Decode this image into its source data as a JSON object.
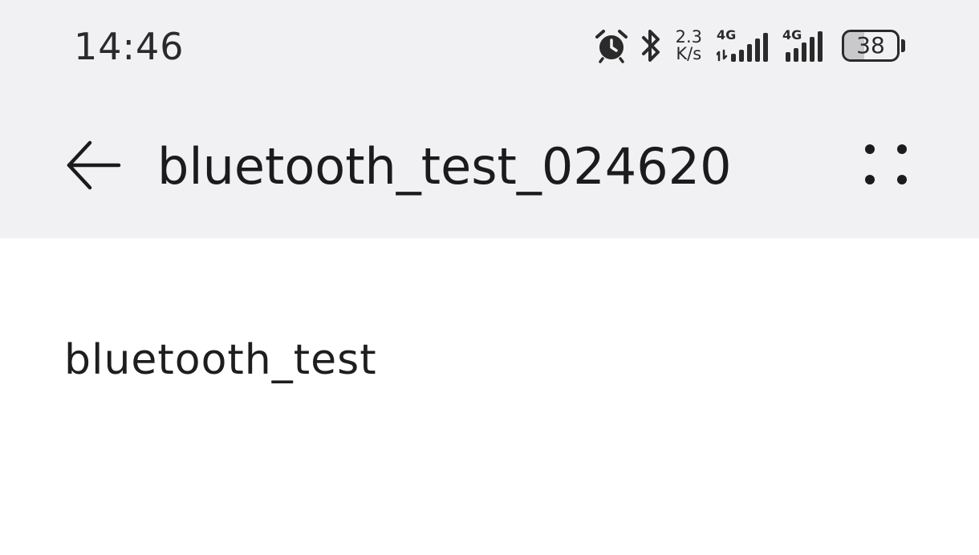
{
  "status_bar": {
    "time": "14:46",
    "icons": [
      "alarm-icon",
      "bluetooth-icon",
      "network-speed",
      "signal-4g-icon",
      "signal-4g-icon",
      "battery-icon"
    ],
    "net_speed_value": "2.3",
    "net_speed_unit": "K/s",
    "sim1_label": "4G",
    "sim2_label": "4G",
    "battery_level": "38",
    "battery_fraction": 0.38
  },
  "app_bar": {
    "back_icon": "back-arrow-icon",
    "title": "bluetooth_test_024620",
    "more_icon": "more-dots-icon"
  },
  "content": {
    "text": "bluetooth_test"
  },
  "colors": {
    "bar_background": "#f1f1f3",
    "content_background": "#ffffff",
    "text": "#1b1b1b"
  }
}
